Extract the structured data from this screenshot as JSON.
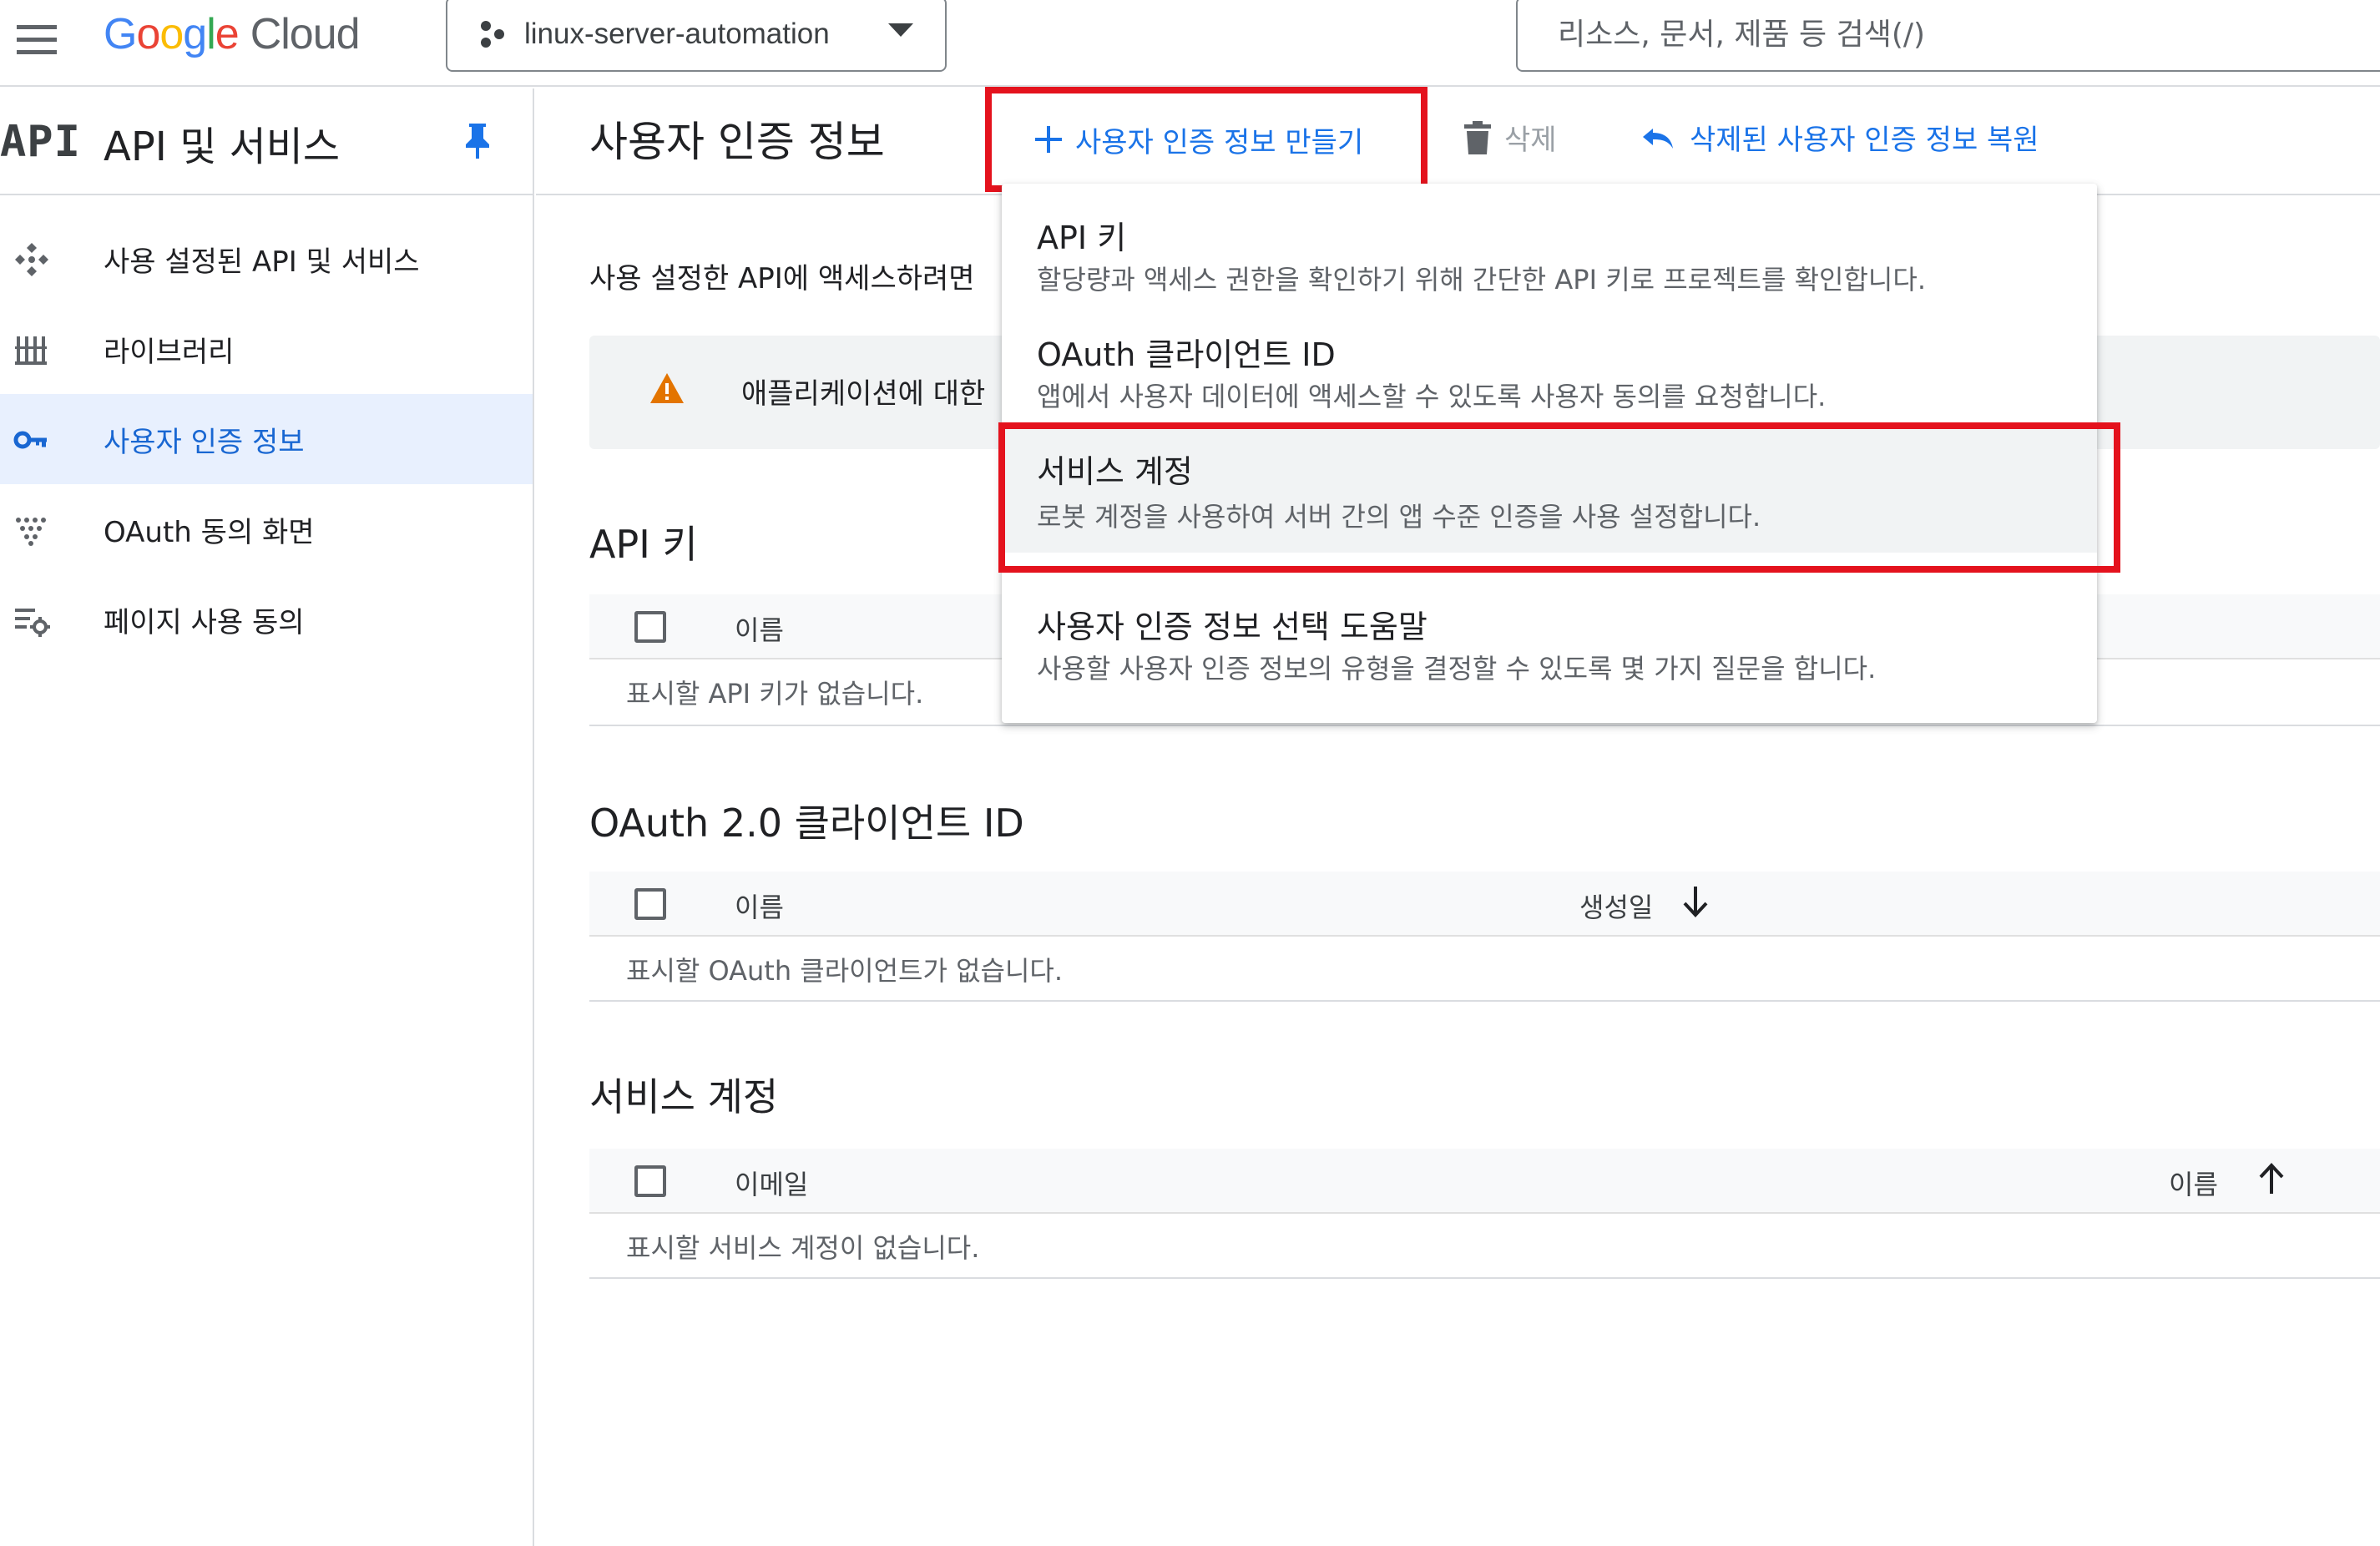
{
  "topbar": {
    "logo": {
      "g1": "G",
      "g2": "o",
      "g3": "o",
      "g4": "g",
      "g5": "l",
      "g6": "e",
      "cloud": "Cloud"
    },
    "project_name": "linux-server-automation",
    "search_placeholder": "리소스, 문서, 제품 등 검색(/)"
  },
  "sidebar": {
    "api_mark": "API",
    "title": "API 및 서비스",
    "items": [
      {
        "label": "사용 설정된 API 및 서비스",
        "icon": "enabled-apis-icon"
      },
      {
        "label": "라이브러리",
        "icon": "library-icon"
      },
      {
        "label": "사용자 인증 정보",
        "icon": "key-icon",
        "active": true
      },
      {
        "label": "OAuth 동의 화면",
        "icon": "oauth-consent-icon"
      },
      {
        "label": "페이지 사용 동의",
        "icon": "page-agreement-icon"
      }
    ]
  },
  "main": {
    "page_title": "사용자 인증 정보",
    "toolbar": {
      "create_label": "사용자 인증 정보 만들기",
      "delete_label": "삭제",
      "restore_label": "삭제된 사용자 인증 정보 복원"
    },
    "description": "사용 설정한 API에 액세스하려면",
    "banner_text": "애플리케이션에 대한",
    "sections": {
      "api_keys": {
        "title": "API 키",
        "columns": [
          "이름"
        ],
        "empty": "표시할 API 키가 없습니다."
      },
      "oauth": {
        "title": "OAuth 2.0 클라이언트 ID",
        "columns": [
          "이름",
          "생성일"
        ],
        "empty": "표시할 OAuth 클라이언트가 없습니다."
      },
      "service_accounts": {
        "title": "서비스 계정",
        "columns": [
          "이메일",
          "이름"
        ],
        "empty": "표시할 서비스 계정이 없습니다."
      }
    }
  },
  "menu": {
    "items": [
      {
        "title": "API 키",
        "desc": "할당량과 액세스 권한을 확인하기 위해 간단한 API 키로 프로젝트를 확인합니다."
      },
      {
        "title": "OAuth 클라이언트 ID",
        "desc": "앱에서 사용자 데이터에 액세스할 수 있도록 사용자 동의를 요청합니다."
      },
      {
        "title": "서비스 계정",
        "desc": "로봇 계정을 사용하여 서버 간의 앱 수준 인증을 사용 설정합니다."
      },
      {
        "title": "사용자 인증 정보 선택 도움말",
        "desc": "사용할 사용자 인증 정보의 유형을 결정할 수 있도록 몇 가지 질문을 합니다."
      }
    ]
  },
  "colors": {
    "accent": "#1a73e8",
    "highlight": "#e4121d",
    "warning": "#e37400",
    "active_bg": "#e8f0fe"
  }
}
